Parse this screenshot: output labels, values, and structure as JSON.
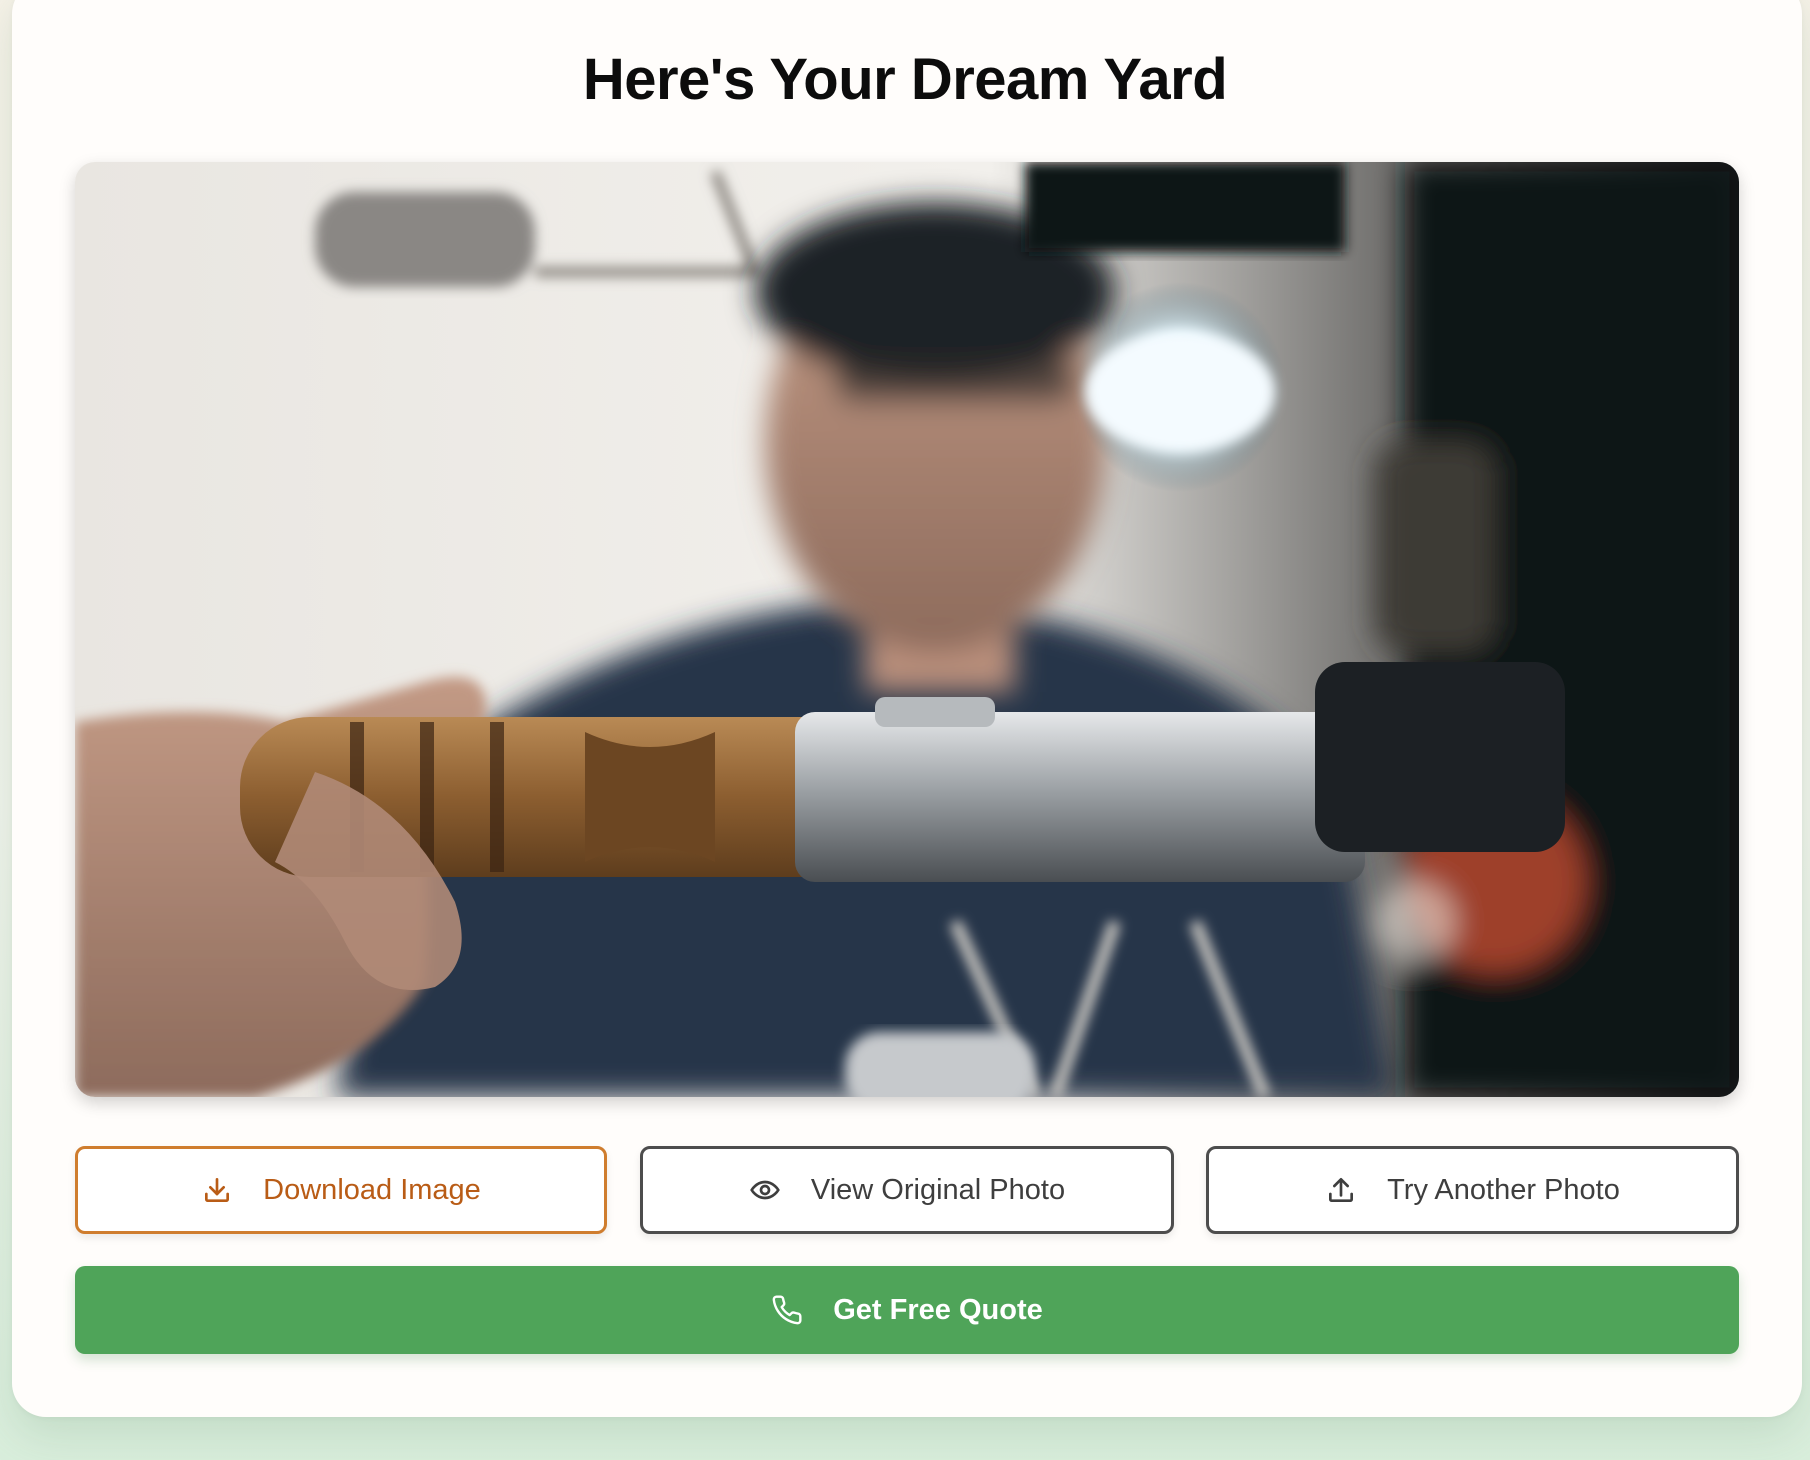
{
  "page": {
    "title": "Here's Your Dream Yard"
  },
  "result_image": {
    "alt": "Generated dream yard image"
  },
  "actions": {
    "download_label": "Download Image",
    "download_icon": "download-icon",
    "view_original_label": "View Original Photo",
    "view_original_icon": "eye-icon",
    "try_another_label": "Try Another Photo",
    "try_another_icon": "upload-icon",
    "quote_label": "Get Free Quote",
    "quote_icon": "phone-icon"
  },
  "colors": {
    "accent_orange": "#cf7d2e",
    "download_text": "#b95c16",
    "quote_green": "#4fa459",
    "neutral_border": "#4d4d4d"
  }
}
